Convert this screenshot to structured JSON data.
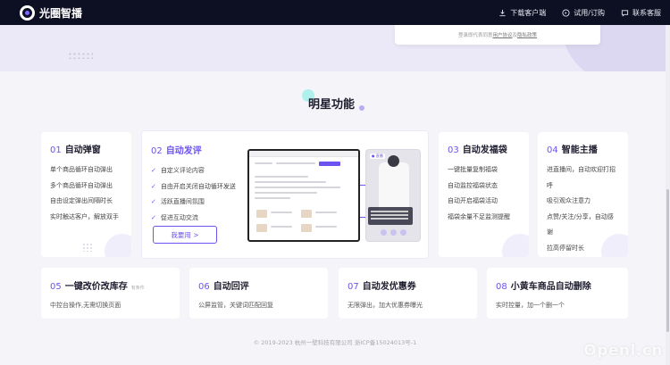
{
  "header": {
    "brand": "光圈智播",
    "nav": [
      {
        "label": "下载客户端",
        "icon": "download-icon"
      },
      {
        "label": "试用/订购",
        "icon": "cart-icon"
      },
      {
        "label": "联系客服",
        "icon": "chat-icon"
      }
    ]
  },
  "hero": {
    "agreement_prefix": "登录即代表同意",
    "user_agreement": "用户协议",
    "and": "及",
    "privacy": "隐私政策"
  },
  "section": {
    "title": "明星功能"
  },
  "cards": [
    {
      "num": "01",
      "title": "自动弹窗",
      "items": [
        "单个商品循环自动弹出",
        "多个商品循环自动弹出",
        "自由设定弹出间隔时长",
        "实时触达客户，解放双手"
      ]
    },
    {
      "num": "02",
      "title": "自动发评",
      "items": [
        "自定义评论内容",
        "自由开启关闭自动循环发送",
        "活跃直播间氛围",
        "促进互动交流"
      ],
      "button": "我要用 >"
    },
    {
      "num": "03",
      "title": "自动发福袋",
      "items": [
        "一键批量复制福袋",
        "自动监控福袋状态",
        "自动开启福袋活动",
        "福袋余量不足监测提醒"
      ]
    },
    {
      "num": "04",
      "title": "智能主播",
      "items": [
        "进直播间，自动欢迎打招呼",
        "吸引观众注意力",
        "点赞/关注/分享，自动感谢",
        "拉高停留时长"
      ]
    },
    {
      "num": "05",
      "title": "一键改价改库存",
      "sub": "有条件",
      "desc": "中控台操作,无需切换页面"
    },
    {
      "num": "06",
      "title": "自动回评",
      "desc": "公屏监管，关键词匹配回复"
    },
    {
      "num": "07",
      "title": "自动发优惠券",
      "desc": "无限弹出，加大优惠券曝光"
    },
    {
      "num": "08",
      "title": "小黄车商品自动删除",
      "desc": "实时控量，加一个删一个"
    }
  ],
  "mock": {
    "phone_tag": "● 直播",
    "shirt_text": "SIGNATURE"
  },
  "footer": {
    "copyright": "© 2019-2023 杭州一壁科技有限公司 浙ICP备15024013号-1"
  },
  "watermark": "Openl.cn",
  "colors": {
    "accent": "#6b54f0",
    "topbar": "#0d0f22"
  }
}
